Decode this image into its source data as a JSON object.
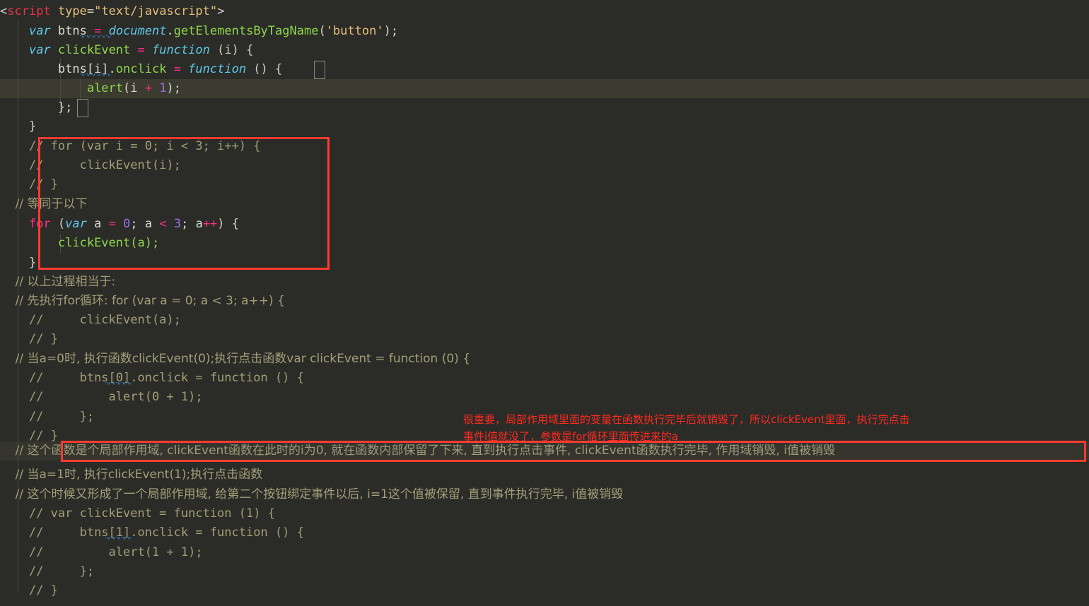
{
  "editor": {
    "theme_name": "monokai-dark",
    "background": "#2b2b28",
    "current_line_background": "#3c3b2f",
    "comment_color": "#a39f78",
    "annotation_color": "#ff2a1f",
    "font_size_px": 17,
    "line_height_px": 27
  },
  "code_lines": [
    {
      "id": "l0",
      "text": ""
    },
    {
      "id": "l1",
      "text": "<script type=\"text/javascript\">"
    },
    {
      "id": "l2",
      "text": "    var btns = document.getElementsByTagName('button');"
    },
    {
      "id": "l3",
      "text": "    var clickEvent = function (i) {"
    },
    {
      "id": "l4",
      "text": "        btns[i].onclick = function () {"
    },
    {
      "id": "l5",
      "text": "            alert(i + 1);"
    },
    {
      "id": "l6",
      "text": "        };"
    },
    {
      "id": "l7",
      "text": "    }"
    },
    {
      "id": "l8",
      "text": "    // for (var i = 0; i < 3; i++) {"
    },
    {
      "id": "l9",
      "text": "    //     clickEvent(i);"
    },
    {
      "id": "l10",
      "text": "    // }"
    },
    {
      "id": "l11",
      "text": "    // 等同于以下"
    },
    {
      "id": "l12",
      "text": "    for (var a = 0; a < 3; a++) {"
    },
    {
      "id": "l13",
      "text": "        clickEvent(a);"
    },
    {
      "id": "l14",
      "text": "    }"
    },
    {
      "id": "l15",
      "text": "    // 以上过程相当于:"
    },
    {
      "id": "l16",
      "text": "    // 先执行for循环: for (var a = 0; a < 3; a++) {"
    },
    {
      "id": "l17",
      "text": "    //     clickEvent(a);"
    },
    {
      "id": "l18",
      "text": "    // }"
    },
    {
      "id": "l19",
      "text": "    // 当a=0时, 执行函数clickEvent(0);执行点击函数var clickEvent = function (0) {"
    },
    {
      "id": "l20",
      "text": "    //     btns[0].onclick = function () {"
    },
    {
      "id": "l21",
      "text": "    //         alert(0 + 1);"
    },
    {
      "id": "l22",
      "text": "    //     };"
    },
    {
      "id": "l23",
      "text": "    // }"
    },
    {
      "id": "l24",
      "text": "    // 这个函数是个局部作用域, clickEvent函数在此时的i为0, 就在函数内部保留了下来, 直到执行点击事件, clickEvent函数执行完毕, 作用域销毁, i值被销毁"
    },
    {
      "id": "l25",
      "text": "    // 当a=1时, 执行clickEvent(1);执行点击函数"
    },
    {
      "id": "l26",
      "text": "    // 这个时候又形成了一个局部作用域, 给第二个按钮绑定事件以后, i=1这个值被保留, 直到事件执行完毕, i值被销毁"
    },
    {
      "id": "l27",
      "text": "    // var clickEvent = function (1) {"
    },
    {
      "id": "l28",
      "text": "    //     btns[1].onclick = function () {"
    },
    {
      "id": "l29",
      "text": "    //         alert(1 + 1);"
    },
    {
      "id": "l30",
      "text": "    //     };"
    },
    {
      "id": "l31",
      "text": "    // }"
    }
  ],
  "tokens": {
    "script_open_lt": "<",
    "script_tag": "script",
    "script_space": " ",
    "attr_type": "type",
    "eq": "=",
    "attr_value": "\"text/javascript\"",
    "gt": ">",
    "indent4": "    ",
    "indent8": "        ",
    "indent12": "            ",
    "kw_var": "var",
    "id_btns": "btns",
    "op_eq": " = ",
    "obj_document": "document",
    "dot": ".",
    "fn_getElements": "getElementsByTagName",
    "paren_open": "(",
    "str_button": "'button'",
    "paren_close_semi": ");",
    "id_clickEvent": "clickEvent",
    "kw_function": "function",
    "args_i": " (i) ",
    "brace_open": "{",
    "btns_i": "btns[i]",
    "prop_onclick": "onclick",
    "args_empty": " () ",
    "fn_alert": "alert",
    "arg_i": "i",
    "op_plus": " + ",
    "num_1": "1",
    "close_paren_semi": ");",
    "brace_close_semi": "};",
    "brace_close": "}",
    "cmt_for_i": "// for (var i = 0; i < 3; i++) {",
    "cmt_clickEvent_i": "//     clickEvent(i);",
    "cmt_brace": "// }",
    "cmt_equivalent": "// 等同于以下",
    "kw_for": "for",
    "for_open": " (",
    "id_a": "a",
    "num_0": "0",
    "semi_sp": "; ",
    "op_lt": "<",
    "num_3": "3",
    "op_pp": "++",
    "for_close": ") ",
    "call_clickEvent_a": "clickEvent(a);",
    "cmt_above_equals": "// 以上过程相当于:",
    "cmt_first_for": "// 先执行for循环: for (var a = 0; a < 3; a++) {",
    "cmt_clickEvent_a": "//     clickEvent(a);",
    "cmt_when_a0": "// 当a=0时, 执行函数clickEvent(0);执行点击函数var clickEvent = function (0) {",
    "cmt_btns0": "//     btns[0].onclick = function () {",
    "cmt_alert0": "//         alert(0 + 1);",
    "cmt_semibrace": "//     };",
    "cmt_local_scope_i0": "// 这个函数是个局部作用域, clickEvent函数在此时的i为0, 就在函数内部保留了下来, 直到执行点击事件, clickEvent函数执行完毕, 作用域销毁, i值被销毁",
    "cmt_when_a1": "// 当a=1时, 执行clickEvent(1);执行点击函数",
    "cmt_local_scope_i1": "// 这个时候又形成了一个局部作用域, 给第二个按钮绑定事件以后, i=1这个值被保留, 直到事件执行完毕, i值被销毁",
    "cmt_var_clickEvent1": "// var clickEvent = function (1) {",
    "cmt_btns1": "//     btns[1].onclick = function () {",
    "cmt_alert1": "//         alert(1 + 1);"
  },
  "annotations": {
    "red_note_line1": "很重要，局部作用域里面的变量在函数执行完毕后就销毁了，所以clickEvent里面，执行完点击",
    "red_note_line2": "事件i值就没了，参数是for循环里面传进来的a",
    "box_code_region_label": "for-loop-highlight-box",
    "box_comment_region_label": "local-scope-comment-highlight-box"
  }
}
